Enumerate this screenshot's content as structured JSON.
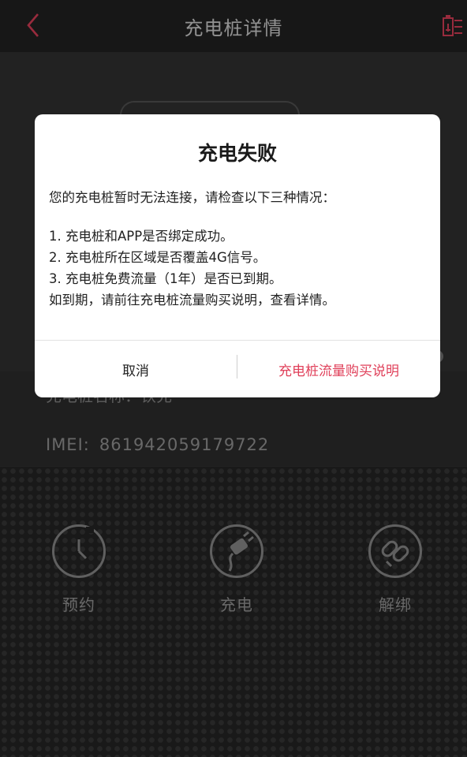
{
  "header": {
    "title": "充电桩详情",
    "back_icon": "chevron-left-icon",
    "battery_icon": "battery-icon"
  },
  "colors": {
    "accent": "#e0405a",
    "header_bg": "#232323",
    "page_bg": "#333333"
  },
  "device": {
    "name_label": "充电桩名称：",
    "name_value": "铁充",
    "imei_label": "IMEI:",
    "imei_value": "861942059179722"
  },
  "actions": [
    {
      "label": "预约",
      "icon": "clock-icon"
    },
    {
      "label": "充电",
      "icon": "plug-icon"
    },
    {
      "label": "解绑",
      "icon": "unlink-icon"
    }
  ],
  "dialog": {
    "title": "充电失败",
    "message": "您的充电桩暂时无法连接，请检查以下三种情况：",
    "items": [
      "1. 充电桩和APP是否绑定成功。",
      "2. 充电桩所在区域是否覆盖4G信号。",
      "3. 充电桩免费流量（1年）是否已到期。",
      "如到期，请前往充电桩流量购买说明，查看详情。"
    ],
    "cancel_label": "取消",
    "info_label": "充电桩流量购买说明"
  }
}
